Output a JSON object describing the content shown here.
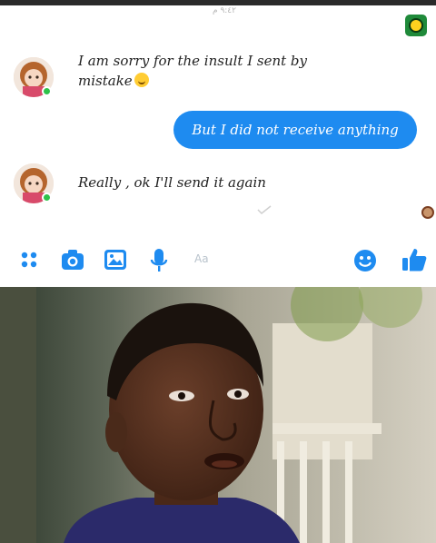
{
  "header": {
    "timestamp": "٩:٤٢ م"
  },
  "messages": [
    {
      "sender": "contact",
      "text_line1": "I am sorry for the insult I sent by",
      "text_line2": "mistake"
    },
    {
      "sender": "me",
      "text": "But I did not receive anything"
    },
    {
      "sender": "contact",
      "text": "Really , ok I'll send it again"
    }
  ],
  "compose": {
    "placeholder": "Aa",
    "icons": [
      "menu-dots-icon",
      "camera-icon",
      "gallery-icon",
      "microphone-icon",
      "emoji-icon",
      "thumbs-up-icon"
    ],
    "accent_color": "#1e8bf0"
  },
  "meme_photo": {
    "description": "reaction photo of a man looking puzzled"
  },
  "colors": {
    "bubble": "#1e8bf0",
    "online": "#2ec24a"
  }
}
